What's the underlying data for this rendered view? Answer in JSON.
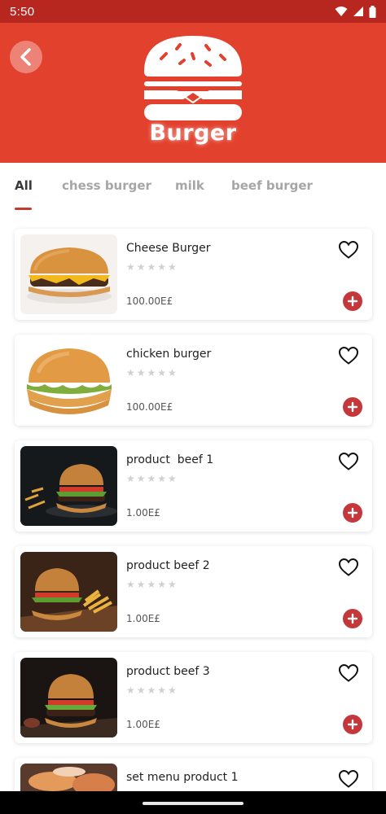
{
  "status_bar": {
    "time": "5:50",
    "icons": [
      "wifi-icon",
      "signal-icon",
      "battery-icon"
    ]
  },
  "header": {
    "title": "Burger",
    "back_icon": "chevron-left-icon",
    "logo_icon": "burger-icon",
    "background_color": "#e2412d"
  },
  "tabs": [
    {
      "label": "All",
      "active": true
    },
    {
      "label": "chess burger",
      "active": false
    },
    {
      "label": "milk",
      "active": false
    },
    {
      "label": "beef burger",
      "active": false
    }
  ],
  "products": [
    {
      "name": "Cheese Burger",
      "price": "100.00E£",
      "rating": "★★★★★",
      "image": "cheese-burger-image"
    },
    {
      "name": "chicken burger",
      "price": "100.00E£",
      "rating": "★★★★★",
      "image": "chicken-burger-image"
    },
    {
      "name": "product  beef 1",
      "price": "1.00E£",
      "rating": "★★★★★",
      "image": "beef-burger-image"
    },
    {
      "name": "product beef 2",
      "price": "1.00E£",
      "rating": "★★★★★",
      "image": "beef-burger-fries-image"
    },
    {
      "name": "product beef 3",
      "price": "1.00E£",
      "rating": "★★★★★",
      "image": "beef-burger-image"
    },
    {
      "name": "set menu product 1",
      "price": "",
      "rating": "★★★★★",
      "image": "set-menu-image"
    }
  ],
  "colors": {
    "accent": "#c4373a",
    "status_bar": "#b7261f"
  }
}
